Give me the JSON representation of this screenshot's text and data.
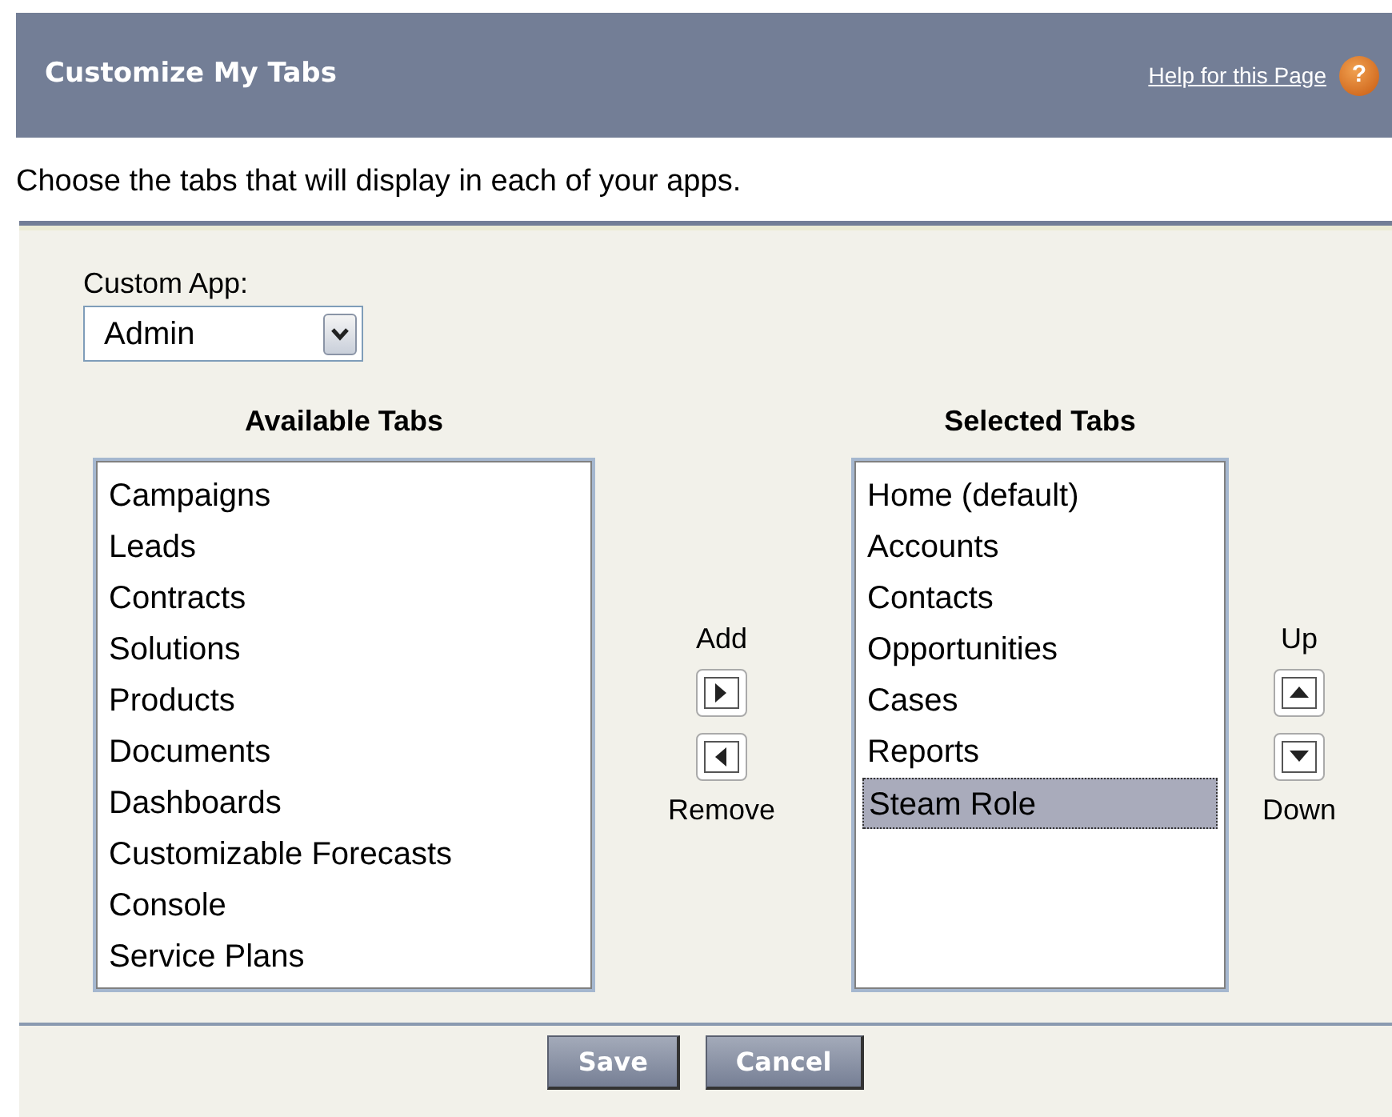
{
  "header": {
    "title": "Customize My Tabs",
    "help_link": "Help for this Page",
    "help_icon": "?"
  },
  "description": "Choose the tabs that will display in each of your apps.",
  "custom_app": {
    "label": "Custom App:",
    "value": "Admin"
  },
  "available": {
    "heading": "Available Tabs",
    "items": [
      {
        "label": "Campaigns",
        "selected": false
      },
      {
        "label": "Leads",
        "selected": false
      },
      {
        "label": "Contracts",
        "selected": false
      },
      {
        "label": "Solutions",
        "selected": false
      },
      {
        "label": "Products",
        "selected": false
      },
      {
        "label": "Documents",
        "selected": false
      },
      {
        "label": "Dashboards",
        "selected": false
      },
      {
        "label": "Customizable Forecasts",
        "selected": false
      },
      {
        "label": "Console",
        "selected": false
      },
      {
        "label": "Service Plans",
        "selected": false
      }
    ]
  },
  "move": {
    "add_label": "Add",
    "remove_label": "Remove"
  },
  "selected_tabs": {
    "heading": "Selected Tabs",
    "items": [
      {
        "label": "Home (default)",
        "selected": false
      },
      {
        "label": "Accounts",
        "selected": false
      },
      {
        "label": "Contacts",
        "selected": false
      },
      {
        "label": "Opportunities",
        "selected": false
      },
      {
        "label": "Cases",
        "selected": false
      },
      {
        "label": "Reports",
        "selected": false
      },
      {
        "label": "Steam Role",
        "selected": true
      }
    ]
  },
  "order": {
    "up_label": "Up",
    "down_label": "Down"
  },
  "buttons": [
    "Save",
    "Cancel"
  ]
}
